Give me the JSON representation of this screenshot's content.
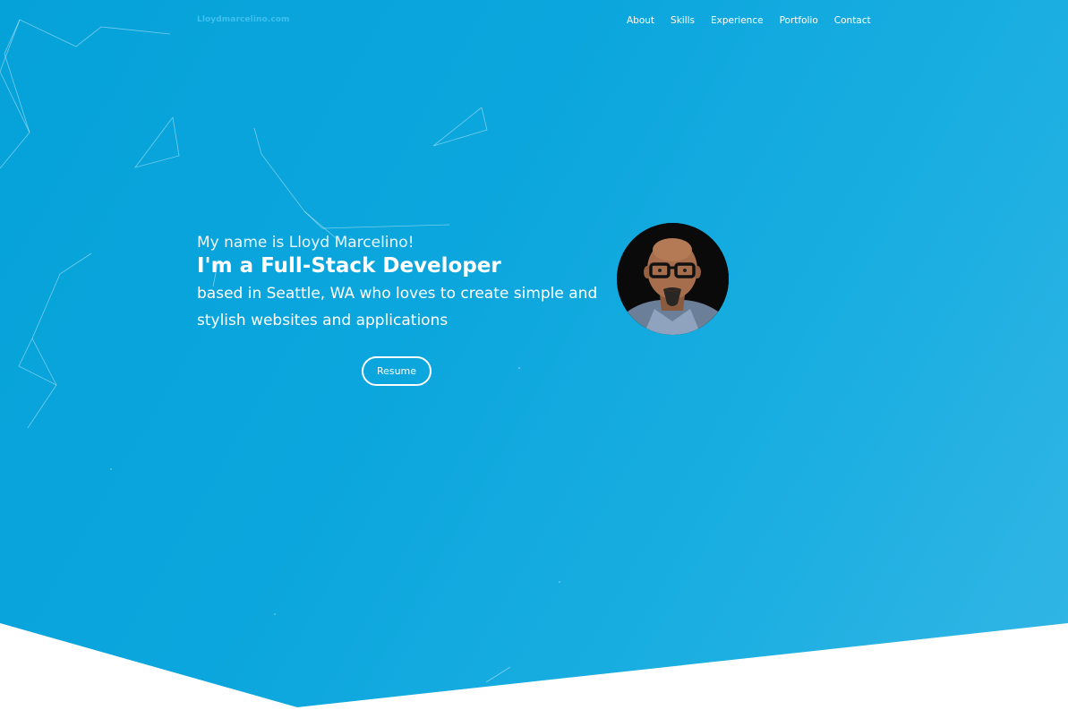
{
  "brand": {
    "logo_text": "Lloydmarcelino.com"
  },
  "nav": {
    "items": [
      {
        "label": "About"
      },
      {
        "label": "Skills"
      },
      {
        "label": "Experience"
      },
      {
        "label": "Portfolio"
      },
      {
        "label": "Contact"
      }
    ]
  },
  "hero": {
    "greeting": "My name is Lloyd Marcelino!",
    "headline": "I'm a Full-Stack Developer",
    "tagline": "based in Seattle, WA who loves to create simple and stylish websites and applications",
    "resume_label": "Resume"
  },
  "colors": {
    "hero_background": "#0ba6dd",
    "text": "#ffffff",
    "page_background": "#ffffff"
  }
}
